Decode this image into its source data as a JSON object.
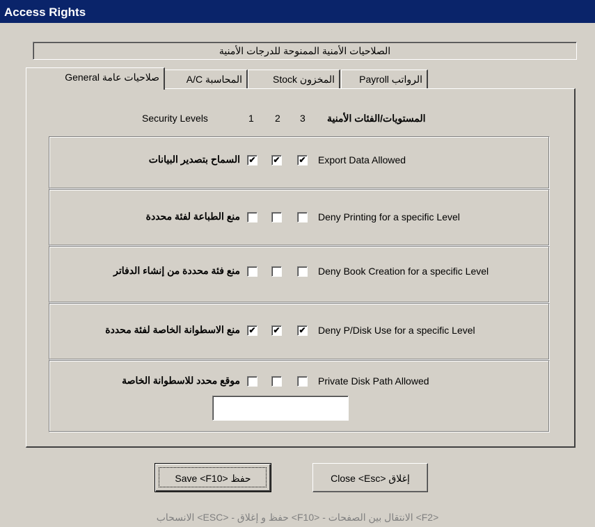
{
  "window": {
    "title": "Access Rights"
  },
  "banner": "الصلاحيات الأمنية الممنوحة للدرجات الأمنية",
  "tabs": [
    {
      "label": "الرواتب Payroll",
      "active": false
    },
    {
      "label": "المخزون Stock",
      "active": false
    },
    {
      "label": "المحاسبة A/C",
      "active": false
    },
    {
      "label": "صلاحيات عامة General",
      "active": true
    }
  ],
  "levels": {
    "english_label": "Security Levels",
    "arabic_label": "المستويات/الفئات الأمنية",
    "numbers": [
      "1",
      "2",
      "3"
    ]
  },
  "permissions": [
    {
      "english": "Export Data Allowed",
      "arabic": "السماح بتصدير البيانات",
      "checked": [
        true,
        true,
        true
      ]
    },
    {
      "english": "Deny Printing for a specific Level",
      "arabic": "منع الطباعة لفئة محددة",
      "checked": [
        false,
        false,
        false
      ]
    },
    {
      "english": "Deny Book Creation for a specific Level",
      "arabic": "منع فئة محددة من إنشاء الدفاتر",
      "checked": [
        false,
        false,
        false
      ]
    },
    {
      "english": "Deny P/Disk Use for a specific Level",
      "arabic": "منع الاسطوانة الخاصة لفئة محددة",
      "checked": [
        true,
        true,
        true
      ]
    },
    {
      "english": "Private Disk Path Allowed",
      "arabic": "موقع محدد للاسطوانة الخاصة",
      "checked": [
        false,
        false,
        false
      ]
    }
  ],
  "private_disk_path": {
    "value": ""
  },
  "buttons": {
    "save": "Save <F10> حفظ",
    "close": "Close <Esc> إغلاق"
  },
  "footer": "<F2> الانتقال بين الصفحات - <F10> حفظ و إغلاق - <ESC> الانسحاب"
}
